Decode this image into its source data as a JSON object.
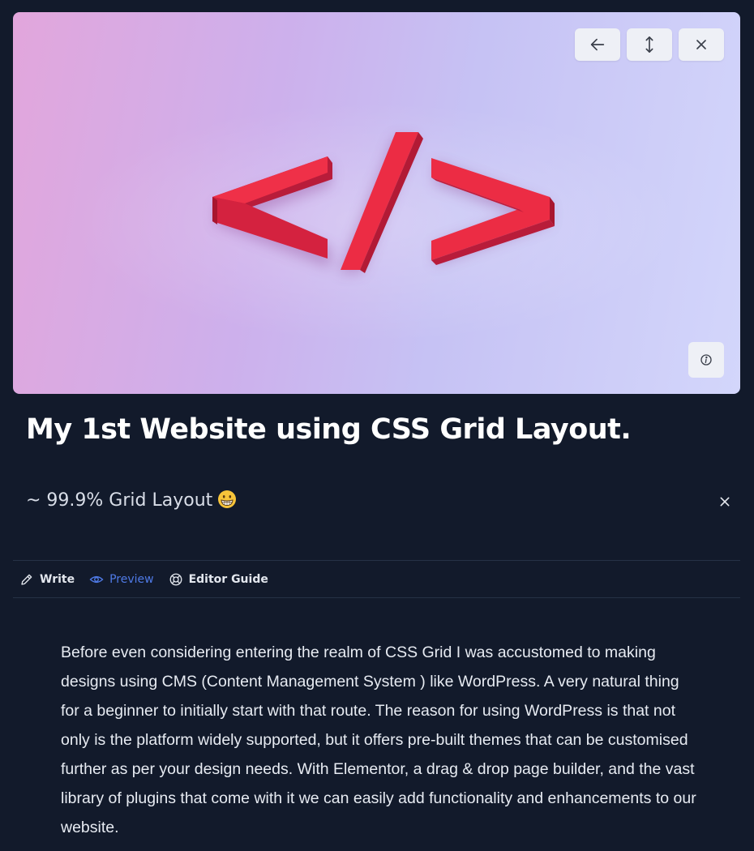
{
  "cover": {
    "icons": {
      "back": "arrow-left-icon",
      "resize": "vertical-resize-icon",
      "close": "close-icon",
      "info": "info-icon",
      "image": "code-symbol-image"
    },
    "accent_color": "#e8283f"
  },
  "article": {
    "title": "My 1st Website using CSS Grid Layout.",
    "subtitle": "~ 99.9% Grid Layout",
    "subtitle_emoji": "grinning-face-icon",
    "body": "Before even considering entering the realm of CSS Grid I was accustomed to making designs using CMS (Content Management System ) like WordPress. A very natural thing for a beginner to initially start with that route. The reason for using WordPress is that not only is the platform widely supported, but it offers pre-built themes that can be customised further as per your design needs. With Elementor, a drag & drop page builder, and the vast library of plugins that come with it we can easily add functionality and enhancements to our website."
  },
  "tabs": [
    {
      "label": "Write",
      "icon": "pencil-icon",
      "active": false
    },
    {
      "label": "Preview",
      "icon": "eye-icon",
      "active": true
    },
    {
      "label": "Editor Guide",
      "icon": "lifebuoy-icon",
      "active": false
    }
  ],
  "colors": {
    "background": "#121a2b",
    "active_tab": "#4f7ae6",
    "divider": "#263146"
  }
}
